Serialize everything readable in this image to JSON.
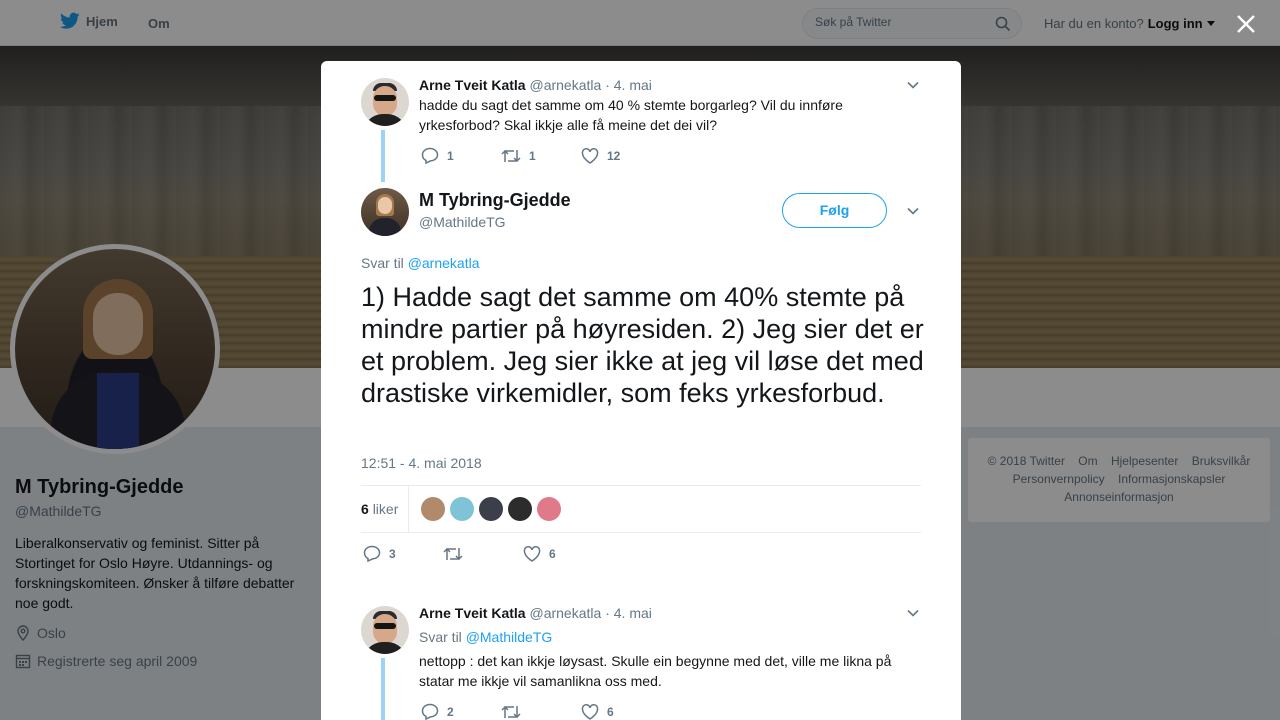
{
  "topnav": {
    "home_label": "Hjem",
    "about_label": "Om",
    "search_placeholder": "Søk på Twitter",
    "account_prompt": "Har du en konto?",
    "login_label": "Logg inn"
  },
  "profile": {
    "name": "M Tybring-Gjedde",
    "handle": "@MathildeTG",
    "bio": "Liberalkonservativ og feminist. Sitter på Stortinget for Oslo Høyre. Utdannings- og forskningskomiteen. Ønsker å tilføre debatter noe godt.",
    "location": "Oslo",
    "joined": "Registrerte seg april 2009"
  },
  "footer": {
    "links": [
      "© 2018 Twitter",
      "Om",
      "Hjelpesenter",
      "Bruksvilkår",
      "Personvernpolicy",
      "Informasjonskapsler",
      "Annonseinformasjon"
    ]
  },
  "tweet_parent": {
    "name": "Arne Tveit Katla",
    "handle": "@arnekatla",
    "dot": "·",
    "date": "4. mai",
    "text": "hadde du sagt det samme om 40 % stemte borgarleg? Vil du innføre yrkesforbod? Skal ikkje alle få meine det dei vil?",
    "replies": "1",
    "retweets": "1",
    "likes": "12"
  },
  "tweet_main": {
    "name": "M Tybring-Gjedde",
    "handle": "@MathildeTG",
    "follow_label": "Følg",
    "reply_prefix": "Svar til",
    "reply_to": "@arnekatla",
    "text": "1) Hadde sagt det samme om 40% stemte på mindre partier på høyresiden. 2) Jeg sier det er et problem. Jeg sier ikke at jeg vil løse det med drastiske virkemidler, som feks yrkesforbud.",
    "timestamp": "12:51 - 4. mai 2018",
    "like_count": "6",
    "like_word": "liker",
    "liker_colors": [
      "#b08a6a",
      "#7fc3d6",
      "#3a3f4a",
      "#2c2c2c",
      "#e07a8a"
    ],
    "replies": "3",
    "retweets": "",
    "likes": "6"
  },
  "tweet_reply": {
    "name": "Arne Tveit Katla",
    "handle": "@arnekatla",
    "dot": "·",
    "date": "4. mai",
    "reply_prefix": "Svar til",
    "reply_to": "@MathildeTG",
    "text": "nettopp : det kan ikkje løysast. Skulle ein begynne med det, ville me likna på statar me ikkje vil samanlikna oss med.",
    "replies": "2",
    "retweets": "",
    "likes": "6"
  },
  "colors": {
    "accent": "#1da1f2",
    "thread_line": "#9bd2f5",
    "text_secondary": "#657786"
  }
}
